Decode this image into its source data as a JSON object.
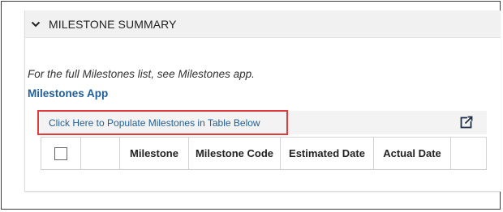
{
  "section": {
    "title": "MILESTONE SUMMARY",
    "note": "For the full Milestones list, see Milestones app.",
    "app_link": "Milestones App"
  },
  "toolbar": {
    "populate_label": "Click Here to Populate Milestones in Table Below",
    "highlight_color": "#e03a3a",
    "link_color": "#1f5f99"
  },
  "table": {
    "columns": [
      "",
      "",
      "Milestone",
      "Milestone Code",
      "Estimated Date",
      "Actual Date",
      ""
    ],
    "rows": []
  },
  "icons": {
    "collapse": "chevron-down-icon",
    "open_external": "external-link-icon"
  }
}
